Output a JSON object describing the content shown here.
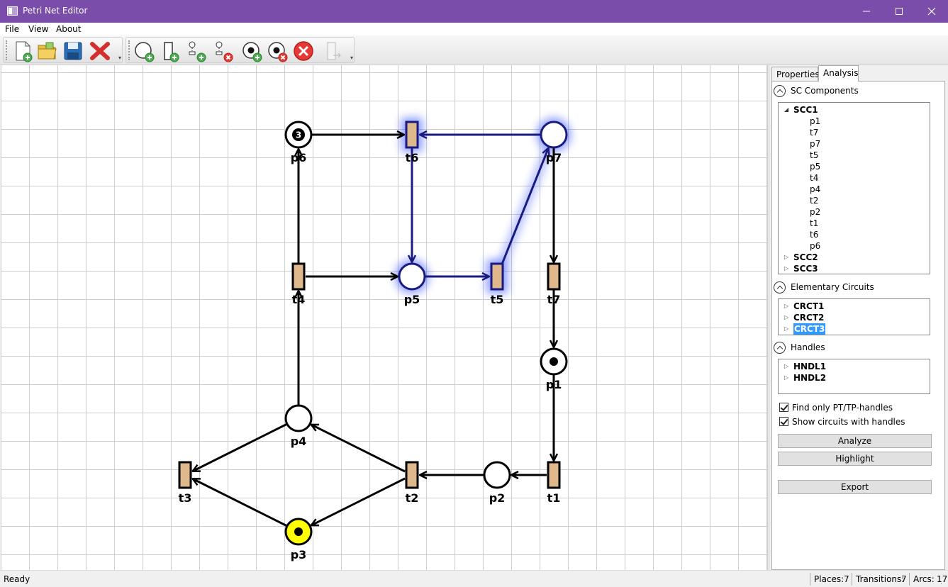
{
  "window": {
    "title": "Petri Net Editor"
  },
  "menu": [
    "File",
    "View",
    "About"
  ],
  "toolbar": {
    "file_icons": [
      "new-file-icon",
      "open-folder-icon",
      "save-icon",
      "delete-icon"
    ],
    "edit_icons": [
      "add-place-icon",
      "add-transition-icon",
      "add-arc-icon",
      "remove-arc-icon",
      "add-token-icon",
      "remove-token-icon",
      "clear-tokens-icon",
      "disabled-run-icon"
    ]
  },
  "net": {
    "places": [
      {
        "id": "p6",
        "label": "p6",
        "tokens": "3"
      },
      {
        "id": "p7",
        "label": "p7",
        "tokens": ""
      },
      {
        "id": "p5",
        "label": "p5",
        "tokens": ""
      },
      {
        "id": "p1",
        "label": "p1",
        "tokens": "•"
      },
      {
        "id": "p4",
        "label": "p4",
        "tokens": ""
      },
      {
        "id": "p2",
        "label": "p2",
        "tokens": ""
      },
      {
        "id": "p3",
        "label": "p3",
        "tokens": "•"
      }
    ],
    "transitions": [
      {
        "id": "t6",
        "label": "t6"
      },
      {
        "id": "t4",
        "label": "t4"
      },
      {
        "id": "t5",
        "label": "t5"
      },
      {
        "id": "t7",
        "label": "t7"
      },
      {
        "id": "t3",
        "label": "t3"
      },
      {
        "id": "t2",
        "label": "t2"
      },
      {
        "id": "t1",
        "label": "t1"
      }
    ],
    "arcs": [
      [
        "p6",
        "t6"
      ],
      [
        "t4",
        "p6"
      ],
      [
        "t4",
        "p5"
      ],
      [
        "t6",
        "p5"
      ],
      [
        "p7",
        "t6"
      ],
      [
        "p5",
        "t5"
      ],
      [
        "t5",
        "p7"
      ],
      [
        "p7",
        "t7"
      ],
      [
        "t7",
        "p1"
      ],
      [
        "p1",
        "t1"
      ],
      [
        "t1",
        "p2"
      ],
      [
        "p2",
        "t2"
      ],
      [
        "t2",
        "p4"
      ],
      [
        "t2",
        "p3"
      ],
      [
        "p4",
        "t3"
      ],
      [
        "p3",
        "t3"
      ],
      [
        "p4",
        "t4"
      ]
    ],
    "highlighted": [
      "p7",
      "t6",
      "p5",
      "t5"
    ],
    "colors": {
      "place_marked": "#ffff00",
      "transition_fill": "#dfb88c",
      "highlight": "#1a1a80",
      "glow": "#3050ff"
    }
  },
  "panel": {
    "tabs": [
      "Properties",
      "Analysis"
    ],
    "active_tab": "Analysis",
    "sc": {
      "header": "SC Components",
      "root": "SCC1",
      "children": [
        "p1",
        "t7",
        "p7",
        "t5",
        "p5",
        "t4",
        "p4",
        "t2",
        "p2",
        "t1",
        "t6",
        "p6"
      ],
      "others": [
        "SCC2",
        "SCC3"
      ]
    },
    "circuits": {
      "header": "Elementary Circuits",
      "items": [
        "CRCT1",
        "CRCT2",
        "CRCT3"
      ],
      "selected": "CRCT3"
    },
    "handles": {
      "header": "Handles",
      "items": [
        "HNDL1",
        "HNDL2"
      ]
    },
    "options": [
      {
        "label": "Find only PT/TP-handles",
        "checked": true
      },
      {
        "label": "Show circuits with handles",
        "checked": true
      }
    ],
    "buttons": {
      "analyze": "Analyze",
      "highlight": "Highlight",
      "export": "Export"
    }
  },
  "status": {
    "ready": "Ready",
    "places_label": "Places:",
    "places": "7",
    "transitions_label": "Transitions:",
    "transitions": "7",
    "arcs_label": "Arcs:",
    "arcs": "17"
  }
}
